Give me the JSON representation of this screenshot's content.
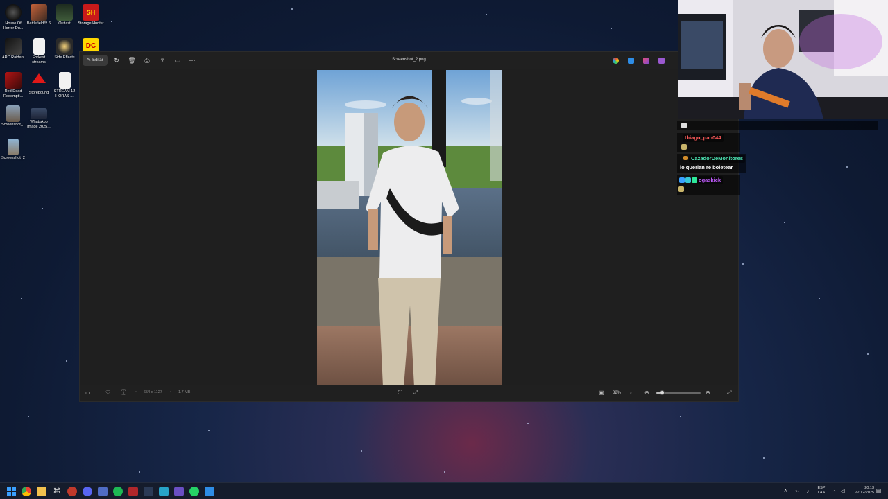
{
  "desktop": {
    "icons": [
      {
        "label": "House Of Horror Du...",
        "icon": "house-of-horror-icon"
      },
      {
        "label": "Battlefield™ 6",
        "icon": "battlefield-icon"
      },
      {
        "label": "Outlast",
        "icon": "outlast-icon"
      },
      {
        "label": "Storage Hunter",
        "icon": "storage-hunter-icon",
        "logo_text": "SH"
      },
      {
        "label": "ARC Raiders",
        "icon": "arc-raiders-icon"
      },
      {
        "label": "Forkast streams",
        "icon": "text-file-icon"
      },
      {
        "label": "Side Effects",
        "icon": "side-effects-icon"
      },
      {
        "label": "",
        "icon": "dc-icon",
        "logo_text": "DC"
      },
      {
        "label": "Red Dead Redempti...",
        "icon": "red-dead-icon"
      },
      {
        "label": "Storebound",
        "icon": "storebound-icon"
      },
      {
        "label": "STREAM 12 HORAS ...",
        "icon": "text-file-icon"
      },
      {
        "label": "Screenshot_1",
        "icon": "image-file-icon"
      },
      {
        "label": "WhatsApp Image 2025...",
        "icon": "image-file-icon"
      },
      {
        "label": "Screenshot_2",
        "icon": "image-file-icon"
      }
    ]
  },
  "photos_window": {
    "title": "Screenshot_2.png",
    "toolbar": {
      "edit_label": "Editar",
      "rotate_icon": "rotate-icon",
      "delete_icon": "trash-icon",
      "print_icon": "print-icon",
      "share_icon": "share-icon",
      "slideshow_icon": "slideshow-icon",
      "more_icon": "more-icon"
    },
    "status": {
      "dimensions": "654 x 1127",
      "size": "1.7 MB",
      "zoom": "82%",
      "zoom_fraction": 0.12
    }
  },
  "chat": {
    "messages": [
      {
        "user": "",
        "text": ""
      },
      {
        "user": "thiago_pan044",
        "text": "",
        "color": "#ff5a5a"
      },
      {
        "user": "CazadorDeMonitores",
        "text": "lo querian re boletear",
        "color": "#4ee8b6"
      },
      {
        "user": "ogaskick",
        "text": "",
        "color": "#c25cff"
      }
    ]
  },
  "taskbar": {
    "language_top": "ESP",
    "language_bottom": "LAA",
    "time": "20:13",
    "date": "22/12/2025"
  },
  "colors": {
    "window_bg": "#1f1f1f",
    "titlebar_bg": "#202020",
    "taskbar_bg": "#151c2c",
    "accent": "#4aa3ff"
  }
}
